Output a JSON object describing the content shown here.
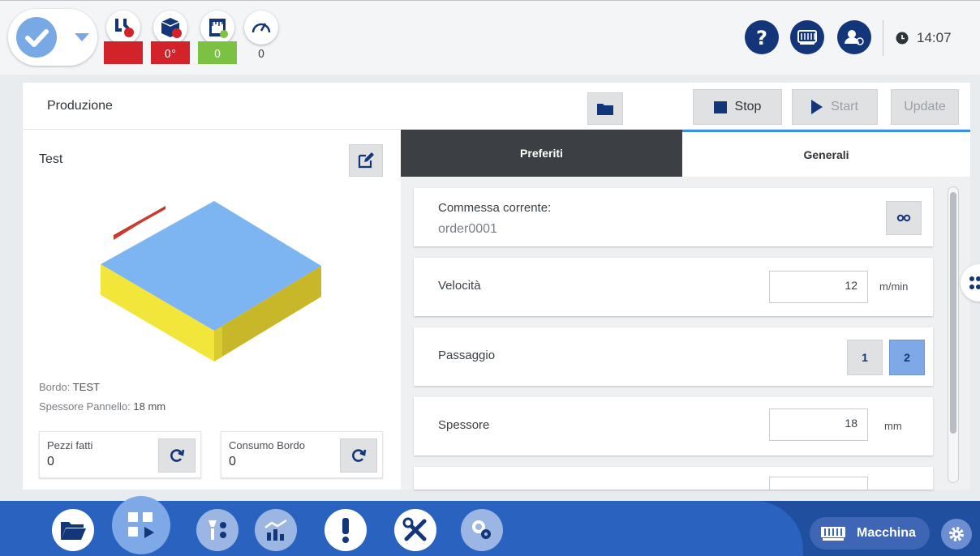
{
  "topbar": {
    "stats": [
      {
        "value": "",
        "color": "#d2232a"
      },
      {
        "value": "0°",
        "color": "#d2232a"
      },
      {
        "value": "0",
        "color": "#7cc242"
      },
      {
        "value": "0",
        "color": ""
      }
    ],
    "icons": [
      "help-icon",
      "machine-icon",
      "user-icon",
      "clock-icon"
    ],
    "time": "14:07"
  },
  "panel": {
    "title": "Produzione",
    "buttons": {
      "stop": "Stop",
      "start": "Start",
      "update": "Update"
    }
  },
  "left": {
    "program_name": "Test",
    "bordo_label": "Bordo:",
    "bordo_value": "TEST",
    "spessore_label": "Spessore Pannello:",
    "spessore_value": "18 mm",
    "counters": [
      {
        "label": "Pezzi fatti",
        "value": "0"
      },
      {
        "label": "Consumo Bordo",
        "value": "0"
      }
    ]
  },
  "tabs": {
    "preferiti": "Preferiti",
    "generali": "Generali",
    "active": "generali"
  },
  "rows": {
    "commessa": {
      "label": "Commessa corrente:",
      "value": "order0001"
    },
    "velocita": {
      "label": "Velocità",
      "value": "12",
      "unit": "m/min"
    },
    "passaggio": {
      "label": "Passaggio",
      "options": [
        "1",
        "2"
      ],
      "selected": "2"
    },
    "spessore": {
      "label": "Spessore",
      "value": "18",
      "unit": "mm"
    }
  },
  "bottombar": {
    "machine_label": "Macchina"
  },
  "colors": {
    "accent": "#2a62c0",
    "dark_navy": "#13357a",
    "selected": "#7ea8e6",
    "panel_yellow": "#f2e63a",
    "panel_top": "#7db4f2",
    "edge_marker": "#c8352c"
  }
}
